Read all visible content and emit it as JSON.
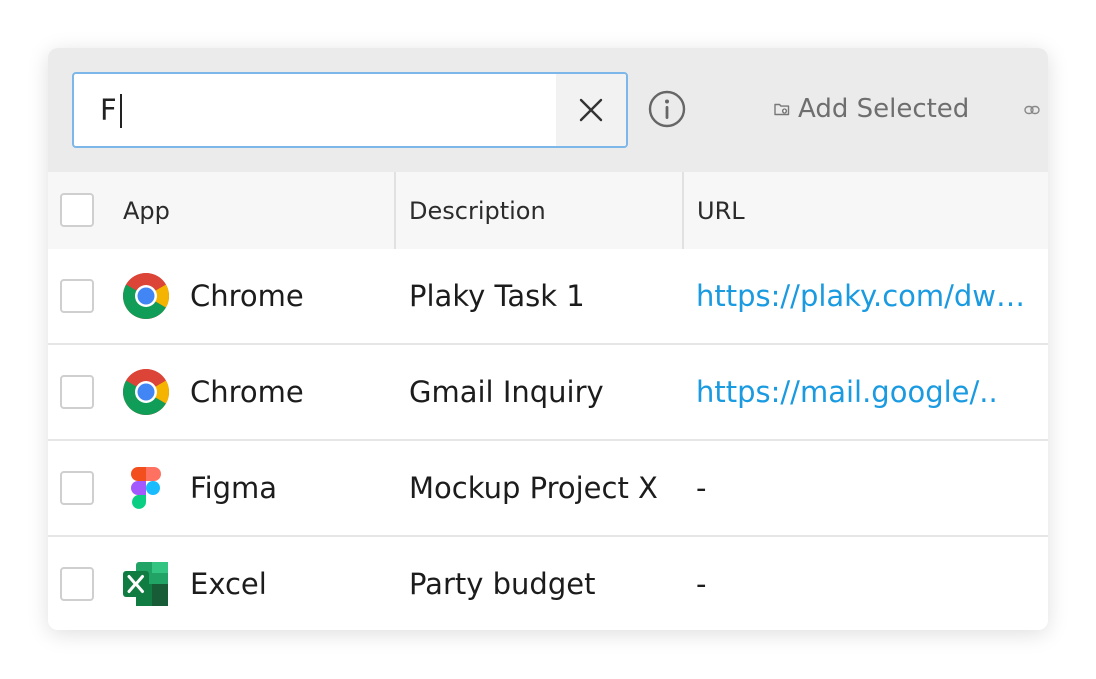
{
  "search": {
    "value": "F",
    "clear_icon": "close-icon"
  },
  "toolbar": {
    "info_icon": "info-circle-icon",
    "add_selected_label": "Add Selected",
    "add_selected_icon": "folder-add-icon",
    "link_icon": "link-icon"
  },
  "table": {
    "columns": [
      "App",
      "Description",
      "URL"
    ],
    "rows": [
      {
        "app": "Chrome",
        "icon": "chrome-icon",
        "description": "Plaky Task 1",
        "url": "https://plaky.com/dw…"
      },
      {
        "app": "Chrome",
        "icon": "chrome-icon",
        "description": "Gmail Inquiry",
        "url": "https://mail.google/.."
      },
      {
        "app": "Figma",
        "icon": "figma-icon",
        "description": "Mockup Project X",
        "url": "-"
      },
      {
        "app": "Excel",
        "icon": "excel-icon",
        "description": "Party budget",
        "url": "-"
      }
    ]
  },
  "colors": {
    "accent": "#1a9ae0",
    "search_border": "#7db6e8",
    "toolbar_bg": "#ebebeb"
  }
}
